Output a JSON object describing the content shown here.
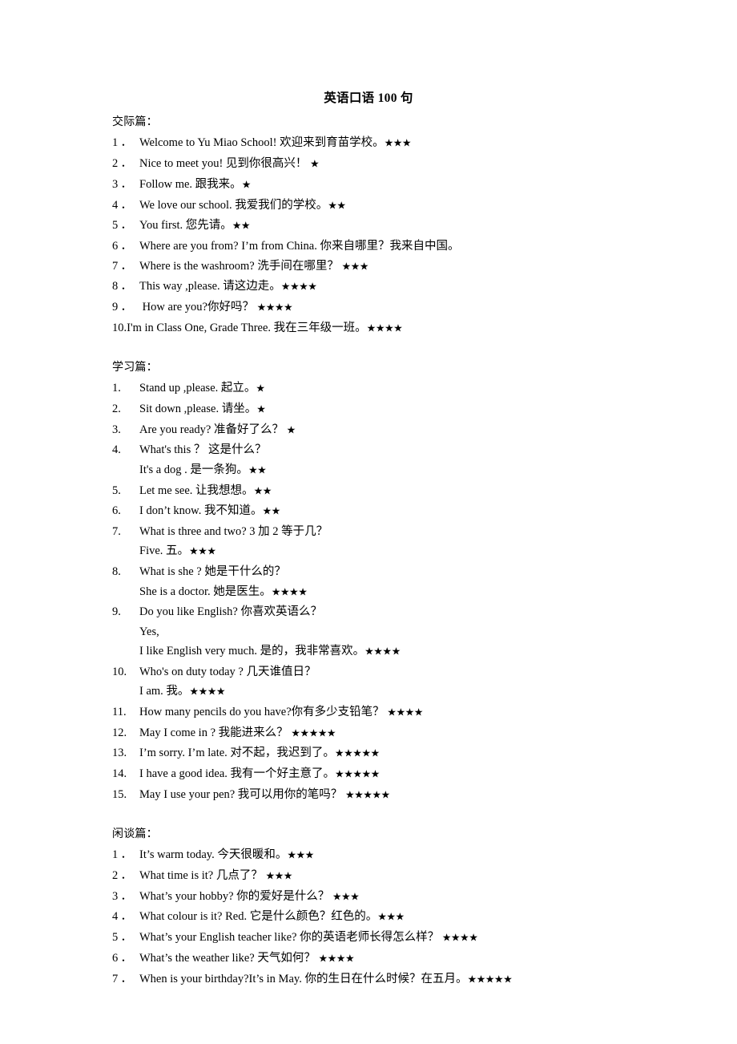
{
  "document": {
    "title": "英语口语 100 句",
    "star_glyph": "★"
  },
  "sections": [
    {
      "heading": "交际篇：",
      "number_style": "wide",
      "items": [
        {
          "num": "1．",
          "text": "Welcome to Yu Miao School!  欢迎来到育苗学校。",
          "stars": 3
        },
        {
          "num": "2．",
          "text": "Nice to meet you!  见到你很高兴！ ",
          "stars": 1
        },
        {
          "num": "3．",
          "text": "Follow me.  跟我来。",
          "stars": 1
        },
        {
          "num": "4．",
          "text": "We love our school.  我爱我们的学校。",
          "stars": 2
        },
        {
          "num": "5．",
          "text": "You first.  您先请。",
          "stars": 2
        },
        {
          "num": "6．",
          "text": "Where are you from? I’m from China.  你来自哪里？我来自中国。",
          "stars": 0
        },
        {
          "num": "7．",
          "text": "Where is the washroom?  洗手间在哪里？ ",
          "stars": 3
        },
        {
          "num": "8．",
          "text": "This way ,please.  请这边走。",
          "stars": 4
        },
        {
          "num": "9．",
          "text": " How are you?你好吗？ ",
          "stars": 4
        },
        {
          "num": "10.",
          "text": "I'm in Class One, Grade Three.  我在三年级一班。",
          "stars": 4,
          "flush": true
        }
      ]
    },
    {
      "heading": "学习篇：",
      "number_style": "narrow",
      "items": [
        {
          "num": "1.",
          "text": "Stand up ,please.  起立。",
          "stars": 1
        },
        {
          "num": "2.",
          "text": "Sit down ,please.  请坐。",
          "stars": 1
        },
        {
          "num": "3.",
          "text": "Are you ready?  准备好了么？ ",
          "stars": 1
        },
        {
          "num": "4.",
          "text": "What's this ？  这是什么？",
          "stars": 0,
          "continuations": [
            {
              "text": "It's a dog .  是一条狗。",
              "stars": 2
            }
          ]
        },
        {
          "num": "5.",
          "text": "Let me see.  让我想想。",
          "stars": 2
        },
        {
          "num": "6.",
          "text": "I don’t know.  我不知道。",
          "stars": 2
        },
        {
          "num": "7.",
          "text": "What is three and two?   3 加 2 等于几？",
          "stars": 0,
          "continuations": [
            {
              "text": "Five.  五。",
              "stars": 3
            }
          ]
        },
        {
          "num": "8.",
          "text": "What is she ?    她是干什么的？",
          "stars": 0,
          "continuations": [
            {
              "text": "She is a doctor.  她是医生。",
              "stars": 4
            }
          ]
        },
        {
          "num": "9.",
          "text": "Do you like English?    你喜欢英语么？",
          "stars": 0,
          "continuations": [
            {
              "text": "Yes,",
              "stars": 0
            },
            {
              "text": "I like English very much.  是的，我非常喜欢。",
              "stars": 4
            }
          ]
        },
        {
          "num": "10.",
          "text": "Who's on duty today ? 几天谁值日？",
          "stars": 0,
          "continuations": [
            {
              "text": "I am.   我。",
              "stars": 4
            }
          ]
        },
        {
          "num": "11.",
          "text": "How many pencils do you have?你有多少支铅笔？ ",
          "stars": 4
        },
        {
          "num": "12.",
          "text": "May I come in ? 我能进来么？ ",
          "stars": 5
        },
        {
          "num": "13.",
          "text": "I’m sorry. I’m late.  对不起，我迟到了。",
          "stars": 5
        },
        {
          "num": "14.",
          "text": "I have a good idea.  我有一个好主意了。",
          "stars": 5
        },
        {
          "num": "15.",
          "text": "May I use your pen?  我可以用你的笔吗？ ",
          "stars": 5
        }
      ]
    },
    {
      "heading": "闲谈篇：",
      "number_style": "wide",
      "items": [
        {
          "num": "1．",
          "text": "It’s warm today.  今天很暖和。",
          "stars": 3
        },
        {
          "num": "2．",
          "text": "What time is it?  几点了？ ",
          "stars": 3
        },
        {
          "num": "3．",
          "text": "What’s your hobby?  你的爱好是什么？ ",
          "stars": 3
        },
        {
          "num": "4．",
          "text": "What colour is it? Red.  它是什么颜色？红色的。",
          "stars": 3
        },
        {
          "num": "5．",
          "text": "What’s your English teacher like?  你的英语老师长得怎么样？ ",
          "stars": 4
        },
        {
          "num": "6．",
          "text": "What’s the weather like?  天气如何？ ",
          "stars": 4
        },
        {
          "num": "7．",
          "text": "When is your birthday?It’s in May.  你的生日在什么时候？在五月。",
          "stars": 5
        }
      ]
    }
  ]
}
